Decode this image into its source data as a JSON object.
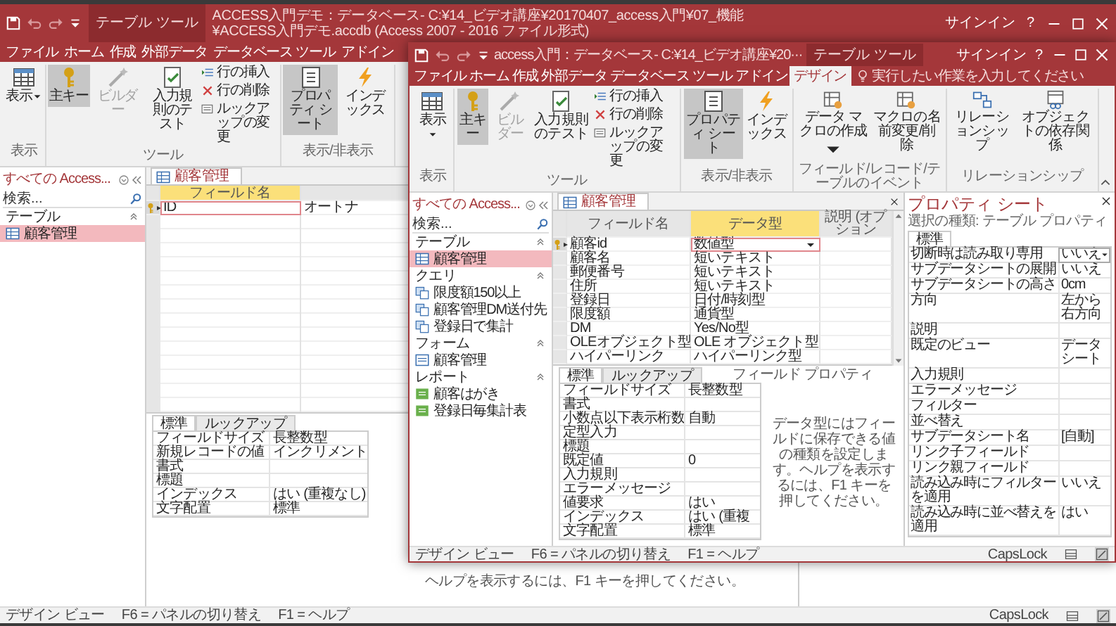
{
  "background_window": {
    "title_bar": {
      "context_tab": "テーブル ツール",
      "title": "ACCESS入門デモ：データベース- C:¥14_ビデオ講座¥20170407_access入門¥07_機能¥ACCESS入門デモ.accdb (Access 2007 - 2016 ファイル形式)",
      "sign_in": "サインイン",
      "help": "?"
    },
    "tabs": [
      {
        "label": "ファイル",
        "selected": false
      },
      {
        "label": "ホーム",
        "selected": false
      },
      {
        "label": "作成",
        "selected": false
      },
      {
        "label": "外部データ",
        "selected": false
      },
      {
        "label": "データベース ツール",
        "selected": false
      },
      {
        "label": "アドイン",
        "selected": false
      }
    ],
    "ribbon": [
      {
        "label": "表示",
        "buttons": [
          {
            "kind": "large",
            "label": "表示",
            "dropdown": true,
            "selected": false,
            "disabled": false
          }
        ]
      },
      {
        "label": "ツール",
        "buttons": [
          {
            "kind": "large",
            "label": "主キー",
            "selected": true,
            "disabled": false
          },
          {
            "kind": "large",
            "label": "ビルダー",
            "selected": false,
            "disabled": true
          },
          {
            "kind": "large",
            "label": "入力規則のテスト",
            "selected": false,
            "disabled": false
          },
          {
            "kind": "small",
            "label": "行の挿入",
            "selected": false,
            "disabled": false
          },
          {
            "kind": "small",
            "label": "行の削除",
            "selected": false,
            "disabled": false
          },
          {
            "kind": "small",
            "label": "ルックアップの変更",
            "selected": false,
            "disabled": false
          }
        ]
      },
      {
        "label": "表示/非表示",
        "buttons": [
          {
            "kind": "large",
            "label": "プロパティ シート",
            "selected": true,
            "disabled": false
          },
          {
            "kind": "large",
            "label": "インデックス",
            "selected": false,
            "disabled": false
          }
        ]
      }
    ],
    "navigation": {
      "title": "すべての Access...",
      "search": {
        "placeholder": "検索..."
      },
      "sections": [
        {
          "kind": "table",
          "label": "テーブル",
          "expanded": true,
          "items": [
            {
              "label": "顧客管理",
              "selected": true
            }
          ]
        }
      ]
    },
    "document_tab": {
      "label": "顧客管理",
      "selected": true
    },
    "design_grid": {
      "columns": [
        {
          "label": "フィールド名",
          "selected": true
        }
      ],
      "rows": [
        {
          "field_name": "ID",
          "data_type": "オートナ",
          "primary_key": true,
          "selected": true
        }
      ]
    },
    "field_properties": {
      "tabs": [
        {
          "label": "標準",
          "selected": true
        },
        {
          "label": "ルックアップ",
          "selected": false
        }
      ],
      "rows": [
        {
          "name": "フィールドサイズ",
          "value": "長整数型"
        },
        {
          "name": "新規レコードの値",
          "value": "インクリメント"
        },
        {
          "name": "書式"
        },
        {
          "name": "標題"
        },
        {
          "name": "インデックス",
          "value": "はい (重複なし)"
        },
        {
          "name": "文字配置",
          "value": "標準"
        }
      ],
      "help_text": "ヘルプを表示するには、F1 キーを押してください。"
    },
    "status_bar": {
      "items": [
        "デザイン ビュー",
        "F6 = パネルの切り替え",
        "F1 = ヘルプ"
      ],
      "caps_lock": "CapsLock"
    }
  },
  "foreground_window": {
    "title_bar": {
      "title": "access入門：データベース- C:¥14_ビデオ講座¥20···",
      "context_tab": "テーブル ツール",
      "sign_in": "サインイン",
      "help": "?"
    },
    "tabs": [
      {
        "label": "ファイル",
        "selected": false
      },
      {
        "label": "ホーム",
        "selected": false
      },
      {
        "label": "作成",
        "selected": false
      },
      {
        "label": "外部データ",
        "selected": false
      },
      {
        "label": "データベース ツール",
        "selected": false
      },
      {
        "label": "アドイン",
        "selected": false
      },
      {
        "label": "デザイン",
        "selected": true
      }
    ],
    "tell_me": {
      "placeholder": "実行したい作業を入力してください"
    },
    "ribbon": [
      {
        "label": "表示",
        "buttons": [
          {
            "kind": "large",
            "label": "表示",
            "dropdown": true,
            "selected": false,
            "disabled": false
          }
        ]
      },
      {
        "label": "ツール",
        "buttons": [
          {
            "kind": "large",
            "label": "主キー",
            "selected": true,
            "disabled": false
          },
          {
            "kind": "large",
            "label": "ビルダー",
            "selected": false,
            "disabled": true
          },
          {
            "kind": "large",
            "label": "入力規則のテスト",
            "selected": false,
            "disabled": false
          },
          {
            "kind": "small",
            "label": "行の挿入",
            "selected": false,
            "disabled": false
          },
          {
            "kind": "small",
            "label": "行の削除",
            "selected": false,
            "disabled": false
          },
          {
            "kind": "small",
            "label": "ルックアップの変更",
            "selected": false,
            "disabled": false
          }
        ]
      },
      {
        "label": "表示/非表示",
        "buttons": [
          {
            "kind": "large",
            "label": "プロパティ シート",
            "selected": true,
            "disabled": false
          },
          {
            "kind": "large",
            "label": "インデックス",
            "selected": false,
            "disabled": false
          }
        ]
      },
      {
        "label": "フィールド/レコード/テーブルのイベント",
        "buttons": [
          {
            "kind": "large",
            "label": "データ マクロの作成",
            "dropdown": true,
            "selected": false,
            "disabled": false
          },
          {
            "kind": "large",
            "label": "マクロの名前変更/削除",
            "selected": false,
            "disabled": false
          }
        ]
      },
      {
        "label": "リレーションシップ",
        "buttons": [
          {
            "kind": "large",
            "label": "リレーションシップ",
            "selected": false,
            "disabled": false
          },
          {
            "kind": "large",
            "label": "オブジェクトの依存関係",
            "selected": false,
            "disabled": false
          }
        ]
      }
    ],
    "navigation": {
      "title": "すべての Access...",
      "search": {
        "placeholder": "検索..."
      },
      "sections": [
        {
          "kind": "table",
          "label": "テーブル",
          "expanded": true,
          "items": [
            {
              "label": "顧客管理",
              "selected": true
            }
          ]
        },
        {
          "kind": "query",
          "label": "クエリ",
          "expanded": true,
          "items": [
            {
              "label": "限度額150以上",
              "selected": false
            },
            {
              "label": "顧客管理DM送付先",
              "selected": false
            },
            {
              "label": "登録日で集計",
              "selected": false
            }
          ]
        },
        {
          "kind": "form",
          "label": "フォーム",
          "expanded": true,
          "items": [
            {
              "label": "顧客管理",
              "selected": false
            }
          ]
        },
        {
          "kind": "report",
          "label": "レポート",
          "expanded": true,
          "items": [
            {
              "label": "顧客はがき",
              "selected": false
            },
            {
              "label": "登録日毎集計表",
              "selected": false
            }
          ]
        }
      ]
    },
    "document_tab": {
      "label": "顧客管理",
      "selected": true
    },
    "design_grid": {
      "columns": [
        {
          "label": "フィールド名",
          "selected": false
        },
        {
          "label": "データ型",
          "selected": true
        },
        {
          "label": "説明 (オプション",
          "selected": false
        }
      ],
      "rows": [
        {
          "field_name": "顧客id",
          "data_type": "数値型",
          "primary_key": true,
          "selected": true
        },
        {
          "field_name": "顧客名",
          "data_type": "短いテキスト",
          "primary_key": false,
          "selected": false
        },
        {
          "field_name": "郵便番号",
          "data_type": "短いテキスト",
          "primary_key": false,
          "selected": false
        },
        {
          "field_name": "住所",
          "data_type": "短いテキスト",
          "primary_key": false,
          "selected": false
        },
        {
          "field_name": "登録日",
          "data_type": "日付/時刻型",
          "primary_key": false,
          "selected": false
        },
        {
          "field_name": "限度額",
          "data_type": "通貨型",
          "primary_key": false,
          "selected": false
        },
        {
          "field_name": "DM",
          "data_type": "Yes/No型",
          "primary_key": false,
          "selected": false
        },
        {
          "field_name": "OLEオブジェクト型",
          "data_type": "OLE オブジェクト型",
          "primary_key": false,
          "selected": false
        },
        {
          "field_name": "ハイパーリンク",
          "data_type": "ハイパーリンク型",
          "primary_key": false,
          "selected": false
        }
      ]
    },
    "field_properties": {
      "caption": "フィールド プロパティ",
      "tabs": [
        {
          "label": "標準",
          "selected": true
        },
        {
          "label": "ルックアップ",
          "selected": false
        }
      ],
      "rows": [
        {
          "name": "フィールドサイズ",
          "value": "長整数型"
        },
        {
          "name": "書式"
        },
        {
          "name": "小数点以下表示桁数",
          "value": "自動"
        },
        {
          "name": "定型入力"
        },
        {
          "name": "標題"
        },
        {
          "name": "既定値",
          "value": "0"
        },
        {
          "name": "入力規則"
        },
        {
          "name": "エラーメッセージ"
        },
        {
          "name": "値要求",
          "value": "はい"
        },
        {
          "name": "インデックス",
          "value": "はい (重複"
        },
        {
          "name": "文字配置",
          "value": "標準"
        }
      ],
      "help_text": "データ型にはフィールドに保存できる値の種類を設定します。ヘルプを表示するには、F1 キーを押してください。"
    },
    "property_sheet": {
      "title": "プロパティ シート",
      "subtitle": "選択の種類: テーブル プロパティ",
      "tabs": [
        {
          "label": "標準",
          "selected": true
        }
      ],
      "rows": [
        {
          "name": "切断時は読み取り専用",
          "value": "いいえ",
          "focused": true
        },
        {
          "name": "サブデータシートの展開",
          "value": "いいえ"
        },
        {
          "name": "サブデータシートの高さ",
          "value": "0cm"
        },
        {
          "name": "方向",
          "value": "左から右方向"
        },
        {
          "name": "説明"
        },
        {
          "name": "既定のビュー",
          "value": "データシート"
        },
        {
          "name": "入力規則"
        },
        {
          "name": "エラーメッセージ"
        },
        {
          "name": "フィルター"
        },
        {
          "name": "並べ替え"
        },
        {
          "name": "サブデータシート名",
          "value": "[自動]"
        },
        {
          "name": "リンク子フィールド"
        },
        {
          "name": "リンク親フィールド"
        },
        {
          "name": "読み込み時にフィルターを適用",
          "value": "いいえ"
        },
        {
          "name": "読み込み時に並べ替えを適用",
          "value": "はい"
        }
      ]
    },
    "status_bar": {
      "items": [
        "デザイン ビュー",
        "F6 = パネルの切り替え",
        "F1 = ヘルプ"
      ],
      "caps_lock": "CapsLock"
    }
  }
}
